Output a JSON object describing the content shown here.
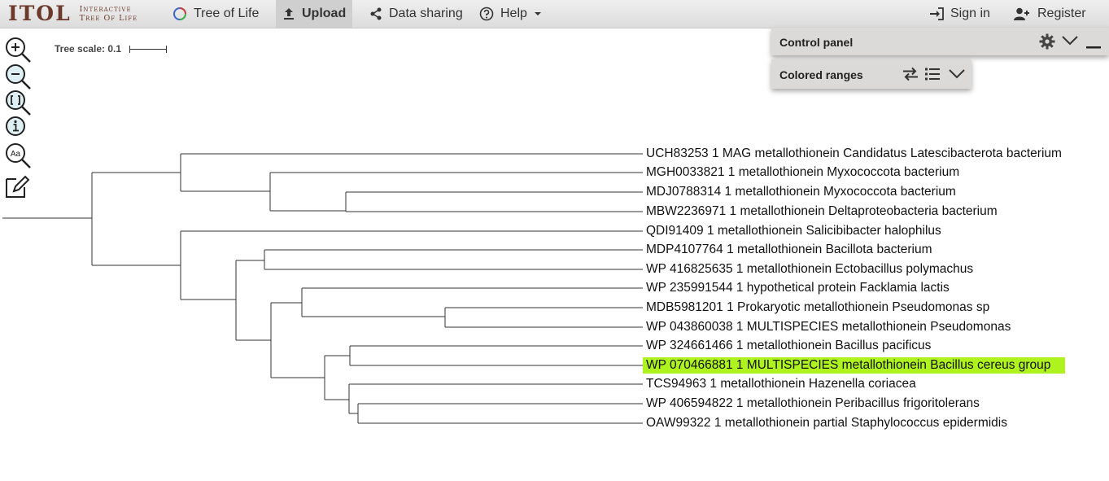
{
  "nav": {
    "logo_main": "ITOL",
    "logo_sub_1": "Interactive",
    "logo_sub_2": "Tree Of Life",
    "tree_of_life": "Tree of Life",
    "upload": "Upload",
    "data_sharing": "Data sharing",
    "help": "Help",
    "sign_in": "Sign in",
    "register": "Register"
  },
  "tree": {
    "scale_label": "Tree scale: 0.1",
    "highlight_color": "#aef21e",
    "leaves": [
      "UCH83253 1 MAG  metallothionein  Candidatus Latescibacterota bacterium",
      "MGH0033821 1 metallothionein  Myxococcota bacterium",
      "MDJ0788314 1 metallothionein  Myxococcota bacterium",
      "MBW2236971 1 metallothionein  Deltaproteobacteria bacterium",
      "QDI91409 1 metallothionein  Salicibibacter halophilus",
      "MDP4107764 1 metallothionein  Bacillota bacterium",
      "WP 416825635 1 metallothionein  Ectobacillus polymachus",
      "WP 235991544 1 hypothetical protein  Facklamia lactis",
      "MDB5981201 1 Prokaryotic metallothionein  Pseudomonas sp",
      "WP 043860038 1 MULTISPECIES  metallothionein  Pseudomonas",
      "WP 324661466 1 metallothionein  Bacillus pacificus",
      "WP 070466881 1 MULTISPECIES  metallothionein  Bacillus cereus group",
      "TCS94963 1 metallothionein  Hazenella coriacea",
      "WP 406594822 1 metallothionein  Peribacillus frigoritolerans",
      "OAW99322 1 metallothionein  partial  Staphylococcus epidermidis"
    ]
  },
  "panels": {
    "control": "Control panel",
    "colored_ranges": "Colored ranges"
  }
}
